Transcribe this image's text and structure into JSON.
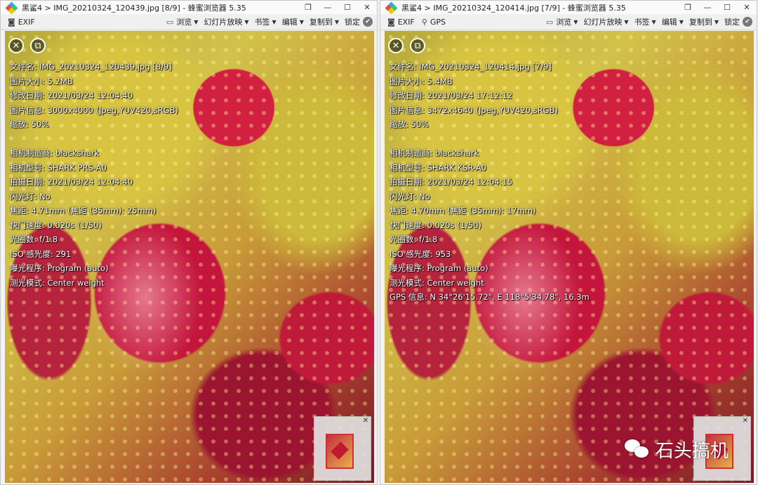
{
  "colors": {
    "title_bg": "#fafafa",
    "toolbar_bg": "#f0f0f0",
    "overlay_text": "#ffffff"
  },
  "menus": [
    {
      "icon": "view-icon",
      "label": "浏览"
    },
    {
      "icon": "slideshow-icon",
      "label": "幻灯片放映"
    },
    {
      "icon": "bookmark-icon",
      "label": "书签"
    },
    {
      "icon": "edit-icon",
      "label": "编辑"
    },
    {
      "icon": "copy-to-icon",
      "label": "复制到"
    }
  ],
  "lock_label": "锁定",
  "window_controls": [
    "❐",
    "—",
    "☐",
    "✕"
  ],
  "left": {
    "title": "黑鲨4 > IMG_20210324_120439.jpg [8/9] - 蜂蜜浏览器 5.35",
    "toolbar_buttons": [
      "EXIF"
    ],
    "info": {
      "file_name": "文件名: IMG_20210324_120439.jpg [8/9]",
      "size": "图片大小: 5.2MB",
      "modified": "修改日期: 2021/03/24 12:04:40",
      "image_info": "图片信息: 3000x4000 (Jpeg,YUV420,sRGB)",
      "zoom": "缩放: 50%",
      "make": "相机制造商: blackshark",
      "model": "相机型号: SHARK PRS-A0",
      "shot_date": "拍摄日期: 2021/03/24 12:04:40",
      "flash": "闪光灯: No",
      "focal": "焦距: 4.71mm (焦距 (35mm): 25mm)",
      "shutter": "快门速度: 0.020s (1/50)",
      "aperture": "光圈数: f/1.8",
      "iso": "ISO 感光度: 291",
      "program": "曝光程序: Program (auto)",
      "metering": "测光模式: Center weight"
    }
  },
  "right": {
    "title": "黑鲨4 > IMG_20210324_120414.jpg [7/9] - 蜂蜜浏览器 5.35",
    "toolbar_buttons": [
      "EXIF",
      "GPS"
    ],
    "info": {
      "file_name": "文件名: IMG_20210324_120414.jpg [7/9]",
      "size": "图片大小: 5.4MB",
      "modified": "修改日期: 2021/03/24 17:12:12",
      "image_info": "图片信息: 3472x4640 (Jpeg,YUV420,sRGB)",
      "zoom": "缩放: 50%",
      "make": "相机制造商: blackshark",
      "model": "相机型号: SHARK KSR-A0",
      "shot_date": "拍摄日期: 2021/03/24 12:04:15",
      "flash": "闪光灯: No",
      "focal": "焦距: 4.70mm (焦距 (35mm): 17mm)",
      "shutter": "快门速度: 0.020s (1/50)",
      "aperture": "光圈数: f/1.8",
      "iso": "ISO 感光度: 953",
      "program": "曝光程序: Program (auto)",
      "metering": "测光模式: Center weight",
      "gps": "GPS 信息: N 34°26'15.72\", E 118°5'34.78\", 16.3m"
    }
  },
  "watermark": "石头搞机"
}
